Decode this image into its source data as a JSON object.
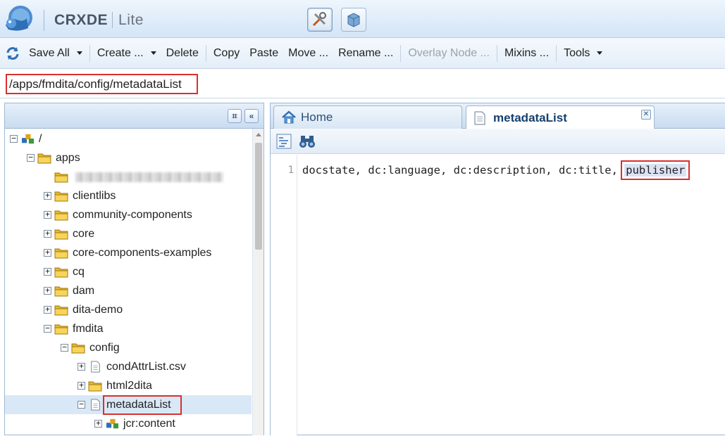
{
  "app": {
    "title_bold": "CRXDE",
    "title_light": "Lite"
  },
  "header": {
    "mode_buttons": [
      "tools-mode-icon",
      "package-mode-icon"
    ]
  },
  "toolbar": {
    "refresh_icon": "refresh-icon",
    "save_all": "Save All",
    "create": "Create ...",
    "delete": "Delete",
    "copy": "Copy",
    "paste": "Paste",
    "move": "Move ...",
    "rename": "Rename ...",
    "overlay_node": "Overlay Node ...",
    "mixins": "Mixins ...",
    "tools": "Tools"
  },
  "path": {
    "value": "/apps/fmdita/config/metadataList"
  },
  "tree": {
    "items": [
      {
        "label": "/",
        "level": 0,
        "expanded": true,
        "icon": "node-icon"
      },
      {
        "label": "apps",
        "level": 1,
        "expanded": true,
        "icon": "folder-icon"
      },
      {
        "label": "",
        "level": 2,
        "expanded": false,
        "icon": "folder-icon",
        "blurred": true
      },
      {
        "label": "clientlibs",
        "level": 2,
        "expanded": false,
        "icon": "folder-icon"
      },
      {
        "label": "community-components",
        "level": 2,
        "expanded": false,
        "icon": "folder-icon"
      },
      {
        "label": "core",
        "level": 2,
        "expanded": false,
        "icon": "folder-icon"
      },
      {
        "label": "core-components-examples",
        "level": 2,
        "expanded": false,
        "icon": "folder-icon"
      },
      {
        "label": "cq",
        "level": 2,
        "expanded": false,
        "icon": "folder-icon"
      },
      {
        "label": "dam",
        "level": 2,
        "expanded": false,
        "icon": "folder-icon"
      },
      {
        "label": "dita-demo",
        "level": 2,
        "expanded": false,
        "icon": "folder-icon"
      },
      {
        "label": "fmdita",
        "level": 2,
        "expanded": true,
        "icon": "folder-icon"
      },
      {
        "label": "config",
        "level": 3,
        "expanded": true,
        "icon": "folder-icon"
      },
      {
        "label": "condAttrList.csv",
        "level": 4,
        "expanded": false,
        "icon": "file-icon"
      },
      {
        "label": "html2dita",
        "level": 4,
        "expanded": false,
        "icon": "folder-icon"
      },
      {
        "label": "metadataList",
        "level": 4,
        "expanded": true,
        "icon": "file-icon",
        "selected": true
      },
      {
        "label": "jcr:content",
        "level": 5,
        "expanded": false,
        "icon": "node-icon"
      }
    ]
  },
  "tabs": [
    {
      "label": "Home",
      "icon": "home-icon",
      "active": false
    },
    {
      "label": "metadataList",
      "icon": "file-icon",
      "active": true
    }
  ],
  "editor": {
    "line_number": "1",
    "code_prefix": "docstate, dc:language, dc:description, dc:title, ",
    "code_highlight": "publisher"
  },
  "colors": {
    "highlight_box": "#d9302e",
    "selection": "#d9e8f6",
    "accent": "#15406e"
  }
}
